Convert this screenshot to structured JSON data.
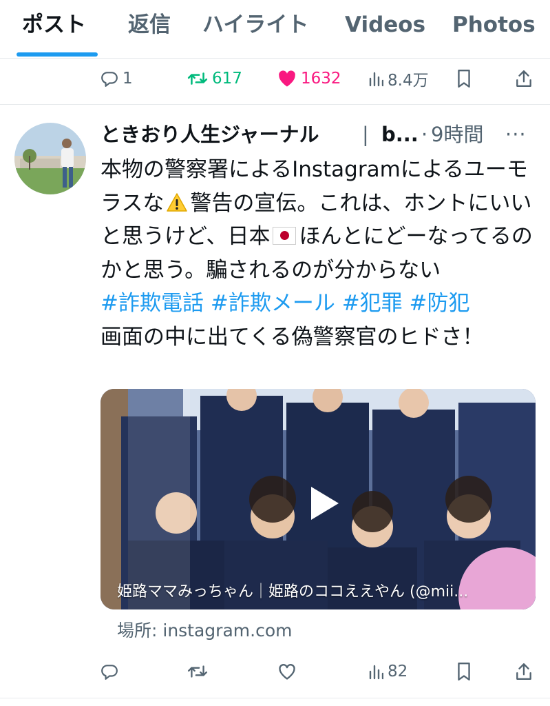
{
  "tabs": [
    {
      "label": "ポスト",
      "active": true
    },
    {
      "label": "返信",
      "active": false
    },
    {
      "label": "ハイライト",
      "active": false
    },
    {
      "label": "Videos",
      "active": false
    },
    {
      "label": "Photos",
      "active": false
    }
  ],
  "prev_post": {
    "replies": "1",
    "retweets": "617",
    "likes": "1632",
    "views": "8.4万"
  },
  "tweet": {
    "display_name": "ときおり人生ジャーナル",
    "separator": "|",
    "handle": "b...",
    "dot": "·",
    "time": "9時間",
    "more": "···",
    "text_part1": "本物の警察署によるInstagramによるユーモラスな",
    "text_part2": "警告の宣伝。これは、ホントにいいと思うけど、日本",
    "text_part3": "ほんとにどーなってるのかと思う。騙されるのが分からない",
    "hashtags": [
      "#詐欺電話",
      "#詐欺メール",
      "#犯罪",
      "#防犯"
    ],
    "text_line_last": "画面の中に出てくる偽警察官のヒドさ！",
    "media_caption": "姫路ママみっちゃん｜姫路のココええやん (@mii...",
    "source": "場所: instagram.com",
    "replies": "",
    "retweets": "",
    "likes": "",
    "views": "82"
  },
  "icons": {
    "reply": "reply-icon",
    "retweet": "retweet-icon",
    "like": "heart-icon",
    "views": "views-icon",
    "bookmark": "bookmark-icon",
    "share": "share-icon"
  },
  "colors": {
    "accent": "#1d9bf0",
    "retweet": "#00ba7c",
    "like": "#f91880",
    "secondary_text": "#536471"
  }
}
